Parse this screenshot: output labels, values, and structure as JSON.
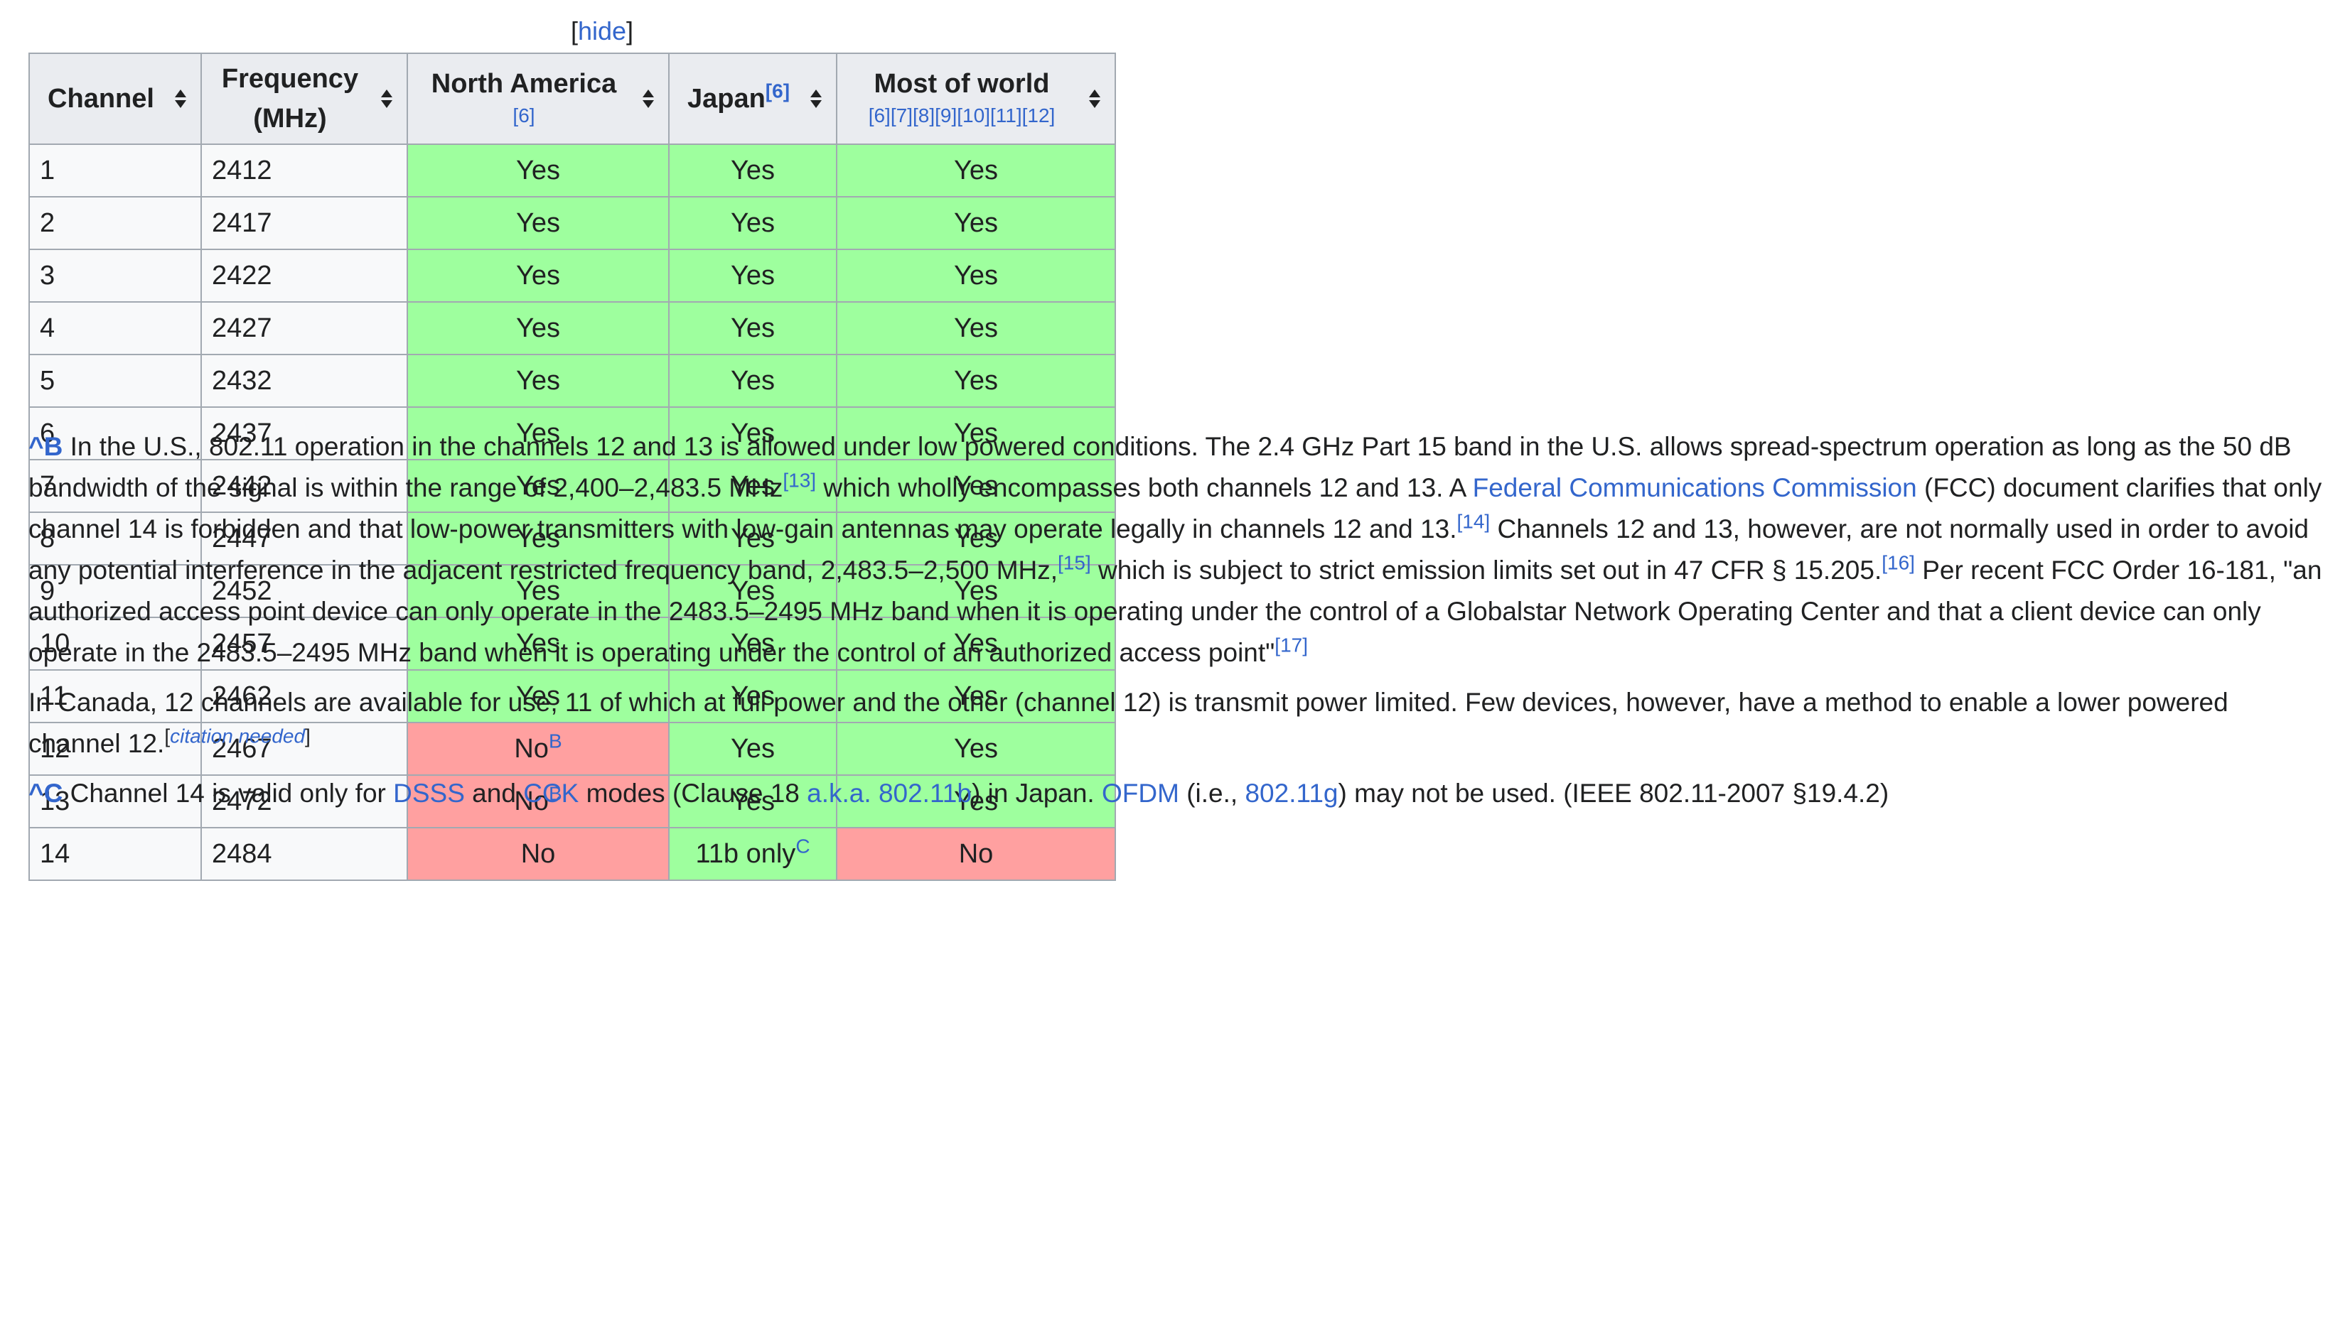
{
  "hide": {
    "open": "[",
    "link": "hide",
    "close": "]"
  },
  "headers": {
    "channel": "Channel",
    "frequency_line1": "Frequency",
    "frequency_line2": "(MHz)",
    "north_america": "North America",
    "north_america_cite": "[6]",
    "japan": "Japan",
    "japan_cite": "[6]",
    "world": "Most of world",
    "world_cites": [
      "[6]",
      "[7]",
      "[8]",
      "[9]",
      "[10]",
      "[11]",
      "[12]"
    ]
  },
  "rows": [
    {
      "channel": "1",
      "freq": "2412",
      "na": "Yes",
      "jp": "Yes",
      "world": "Yes"
    },
    {
      "channel": "2",
      "freq": "2417",
      "na": "Yes",
      "jp": "Yes",
      "world": "Yes"
    },
    {
      "channel": "3",
      "freq": "2422",
      "na": "Yes",
      "jp": "Yes",
      "world": "Yes"
    },
    {
      "channel": "4",
      "freq": "2427",
      "na": "Yes",
      "jp": "Yes",
      "world": "Yes"
    },
    {
      "channel": "5",
      "freq": "2432",
      "na": "Yes",
      "jp": "Yes",
      "world": "Yes"
    },
    {
      "channel": "6",
      "freq": "2437",
      "na": "Yes",
      "jp": "Yes",
      "world": "Yes"
    },
    {
      "channel": "7",
      "freq": "2442",
      "na": "Yes",
      "jp": "Yes",
      "world": "Yes"
    },
    {
      "channel": "8",
      "freq": "2447",
      "na": "Yes",
      "jp": "Yes",
      "world": "Yes"
    },
    {
      "channel": "9",
      "freq": "2452",
      "na": "Yes",
      "jp": "Yes",
      "world": "Yes"
    },
    {
      "channel": "10",
      "freq": "2457",
      "na": "Yes",
      "jp": "Yes",
      "world": "Yes"
    },
    {
      "channel": "11",
      "freq": "2462",
      "na": "Yes",
      "jp": "Yes",
      "world": "Yes"
    },
    {
      "channel": "12",
      "freq": "2467",
      "na": "No",
      "na_note": "B",
      "jp": "Yes",
      "world": "Yes"
    },
    {
      "channel": "13",
      "freq": "2472",
      "na": "No",
      "na_note": "B",
      "jp": "Yes",
      "world": "Yes"
    },
    {
      "channel": "14",
      "freq": "2484",
      "na": "No",
      "jp": "11b only",
      "jp_note": "C",
      "world": "No"
    }
  ],
  "colors": {
    "yes": "#9eff9e",
    "no": "#ffa0a0",
    "header": "#eaecf0",
    "link": "#3366cc"
  },
  "notes": {
    "b_marker": "^B",
    "b_p1": [
      {
        "t": "In the U.S., 802.11 operation in the channels 12 and 13 is allowed under low powered conditions. The 2.4 GHz Part 15 band in the U.S. allows spread-spectrum operation as long as the 50 dB bandwidth of the signal is within the range of 2,400–2,483.5 MHz"
      },
      {
        "sup": "[13]"
      },
      {
        "t": " which wholly encompasses both channels 12 and 13. A "
      },
      {
        "link": "Federal Communications Commission"
      },
      {
        "t": " (FCC) document clarifies that only channel 14 is forbidden and that low-power transmitters with low-gain antennas may operate legally in channels 12 and 13."
      },
      {
        "sup": "[14]"
      },
      {
        "t": " Channels 12 and 13, however, are not normally used in order to avoid any potential interference in the adjacent restricted frequency band, 2,483.5–2,500 MHz,"
      },
      {
        "sup": "[15]"
      },
      {
        "t": " which is subject to strict emission limits set out in 47 CFR § 15.205."
      },
      {
        "sup": "[16]"
      },
      {
        "t": " Per recent FCC Order 16-181, \"an authorized access point device can only operate in the 2483.5–2495 MHz band when it is operating under the control of a Globalstar Network Operating Center and that a client device can only operate in the 2483.5–2495 MHz band when it is operating under the control of an authorized access point\""
      },
      {
        "sup": "[17]"
      }
    ],
    "b_p2": [
      {
        "t": "In Canada, 12 channels are available for use, 11 of which at full power and the other (channel 12) is transmit power limited. Few devices, however, have a method to enable a lower powered channel 12."
      },
      {
        "supcn": "citation needed"
      }
    ],
    "c_marker": "^C",
    "c_p": [
      {
        "t": " Channel 14 is valid only for "
      },
      {
        "link": "DSSS"
      },
      {
        "t": " and "
      },
      {
        "link": "CCK"
      },
      {
        "t": " modes (Clause 18 "
      },
      {
        "link": "a.k.a."
      },
      {
        "t": " "
      },
      {
        "link": "802.11b"
      },
      {
        "t": ") in Japan. "
      },
      {
        "link": "OFDM"
      },
      {
        "t": " (i.e., "
      },
      {
        "link": "802.11g"
      },
      {
        "t": ") may not be used. (IEEE 802.11-2007 §19.4.2)"
      }
    ]
  }
}
